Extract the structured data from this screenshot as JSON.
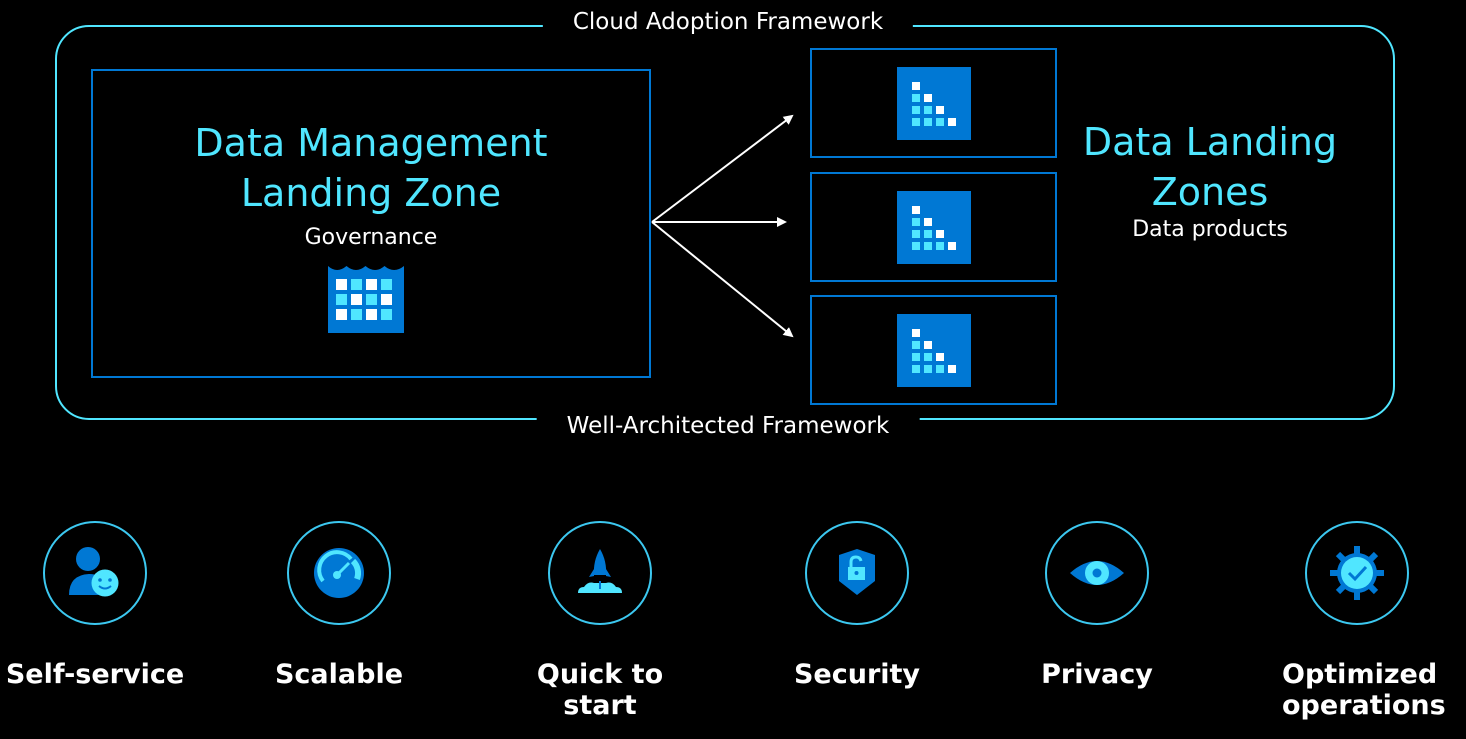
{
  "frameworks": {
    "top_label": "Cloud Adoption Framework",
    "bottom_label": "Well-Architected Framework"
  },
  "data_management_landing_zone": {
    "title_line1": "Data Management",
    "title_line2": "Landing Zone",
    "subtitle": "Governance",
    "icon": "data-lake-icon"
  },
  "data_landing_zones": {
    "title_line1": "Data Landing",
    "title_line2": "Zones",
    "subtitle": "Data products",
    "zones": [
      {
        "icon": "analytics-staircase-icon"
      },
      {
        "icon": "analytics-staircase-icon"
      },
      {
        "icon": "analytics-staircase-icon"
      }
    ]
  },
  "features": [
    {
      "label": "Self-service",
      "icon": "user-smile-icon"
    },
    {
      "label": "Scalable",
      "icon": "gauge-icon"
    },
    {
      "label": "Quick to start",
      "icon": "rocket-icon"
    },
    {
      "label": "Security",
      "icon": "shield-lock-icon"
    },
    {
      "label": "Privacy",
      "icon": "eye-icon"
    },
    {
      "label": "Optimized operations",
      "icon": "gear-check-icon"
    }
  ],
  "colors": {
    "accent_cyan": "#50e6ff",
    "accent_blue": "#0078d4",
    "background": "#000000",
    "text": "#ffffff"
  }
}
